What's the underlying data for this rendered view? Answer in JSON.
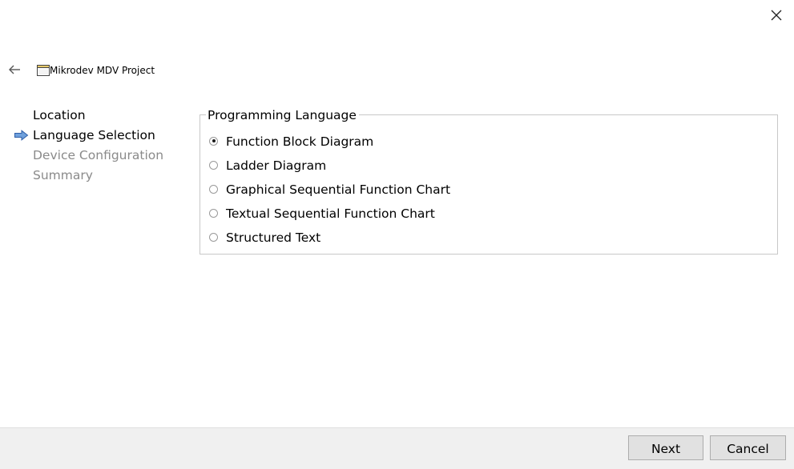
{
  "window": {
    "title": "Mikrodev MDV Project"
  },
  "icons": {
    "close": "close-icon",
    "back": "back-arrow-icon",
    "app": "window-icon",
    "current_step": "right-arrow-icon"
  },
  "steps": [
    {
      "label": "Location",
      "state": "done"
    },
    {
      "label": "Language Selection",
      "state": "current"
    },
    {
      "label": "Device Configuration",
      "state": "pending"
    },
    {
      "label": "Summary",
      "state": "pending"
    }
  ],
  "language_group": {
    "legend": "Programming Language",
    "selected": "Function Block Diagram",
    "options": [
      {
        "label": "Function Block Diagram",
        "checked": true
      },
      {
        "label": "Ladder Diagram",
        "checked": false
      },
      {
        "label": "Graphical Sequential Function Chart",
        "checked": false
      },
      {
        "label": "Textual Sequential Function Chart",
        "checked": false
      },
      {
        "label": "Structured Text",
        "checked": false
      }
    ]
  },
  "buttons": {
    "next": "Next",
    "cancel": "Cancel"
  },
  "colors": {
    "pending_step": "#8a8a8a",
    "arrow_fill": "#6fa0dc",
    "arrow_stroke": "#2f5fa8",
    "footer_bg": "#f0f0f0"
  }
}
